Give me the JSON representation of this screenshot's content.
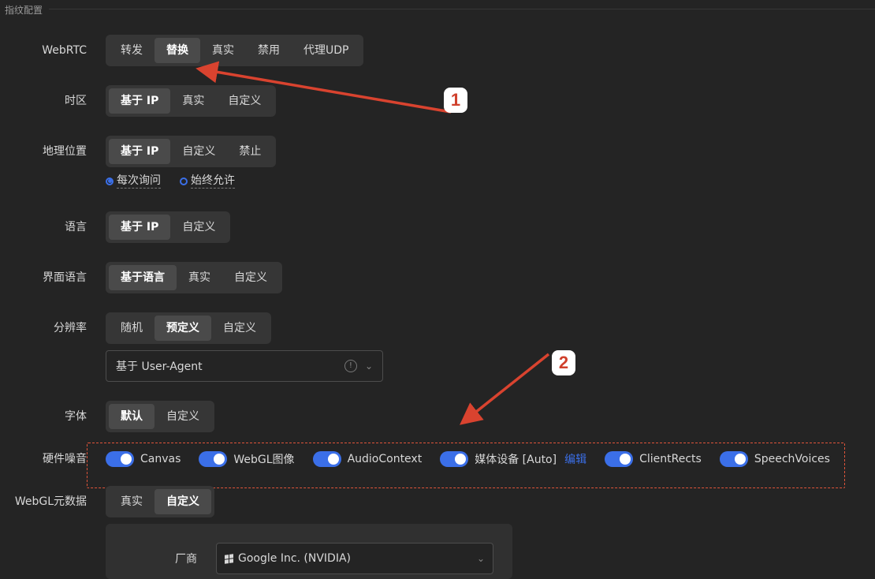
{
  "section": {
    "title": "指纹配置"
  },
  "rows": {
    "webrtc": {
      "label": "WebRTC",
      "options": [
        "转发",
        "替换",
        "真实",
        "禁用",
        "代理UDP"
      ],
      "active": 1
    },
    "timezone": {
      "label": "时区",
      "options": [
        "基于 IP",
        "真实",
        "自定义"
      ],
      "active": 0
    },
    "geo": {
      "label": "地理位置",
      "options": [
        "基于 IP",
        "自定义",
        "禁止"
      ],
      "active": 0,
      "radios": [
        {
          "label": "每次询问",
          "checked": true
        },
        {
          "label": "始终允许",
          "checked": false
        }
      ]
    },
    "language": {
      "label": "语言",
      "options": [
        "基于 IP",
        "自定义"
      ],
      "active": 0
    },
    "ui_language": {
      "label": "界面语言",
      "options": [
        "基于语言",
        "真实",
        "自定义"
      ],
      "active": 0
    },
    "resolution": {
      "label": "分辨率",
      "options": [
        "随机",
        "预定义",
        "自定义"
      ],
      "active": 1,
      "select_value": "基于 User-Agent"
    },
    "font": {
      "label": "字体",
      "options": [
        "默认",
        "自定义"
      ],
      "active": 0
    },
    "hardware_noise": {
      "label": "硬件噪音",
      "toggles": [
        {
          "label": "Canvas",
          "on": true
        },
        {
          "label": "WebGL图像",
          "on": true
        },
        {
          "label": "AudioContext",
          "on": true
        },
        {
          "label": "媒体设备 [Auto]",
          "on": true,
          "link": "编辑"
        },
        {
          "label": "ClientRects",
          "on": true
        },
        {
          "label": "SpeechVoices",
          "on": true
        }
      ]
    },
    "webgl_meta": {
      "label": "WebGL元数据",
      "options": [
        "真实",
        "自定义"
      ],
      "active": 1,
      "vendor_label": "厂商",
      "vendor_value": "Google Inc. (NVIDIA)"
    }
  },
  "annotations": {
    "badge1": "1",
    "badge2": "2",
    "arrow_color": "#d9432f"
  },
  "colors": {
    "accent": "#3b6fe8",
    "background": "#242424"
  }
}
